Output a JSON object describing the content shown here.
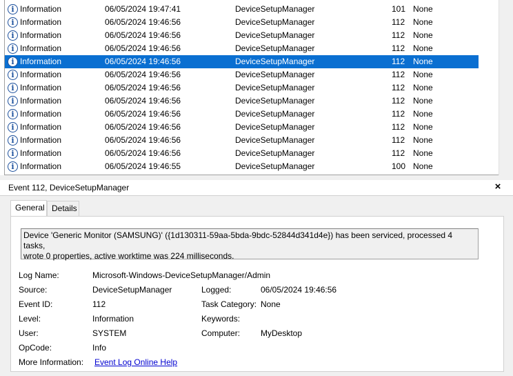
{
  "event_list": {
    "rows": [
      {
        "level": "Information",
        "date": "06/05/2024 19:47:41",
        "source": "DeviceSetupManager",
        "event_id": "101",
        "task": "None",
        "selected": false
      },
      {
        "level": "Information",
        "date": "06/05/2024 19:46:56",
        "source": "DeviceSetupManager",
        "event_id": "112",
        "task": "None",
        "selected": false
      },
      {
        "level": "Information",
        "date": "06/05/2024 19:46:56",
        "source": "DeviceSetupManager",
        "event_id": "112",
        "task": "None",
        "selected": false
      },
      {
        "level": "Information",
        "date": "06/05/2024 19:46:56",
        "source": "DeviceSetupManager",
        "event_id": "112",
        "task": "None",
        "selected": false
      },
      {
        "level": "Information",
        "date": "06/05/2024 19:46:56",
        "source": "DeviceSetupManager",
        "event_id": "112",
        "task": "None",
        "selected": true
      },
      {
        "level": "Information",
        "date": "06/05/2024 19:46:56",
        "source": "DeviceSetupManager",
        "event_id": "112",
        "task": "None",
        "selected": false
      },
      {
        "level": "Information",
        "date": "06/05/2024 19:46:56",
        "source": "DeviceSetupManager",
        "event_id": "112",
        "task": "None",
        "selected": false
      },
      {
        "level": "Information",
        "date": "06/05/2024 19:46:56",
        "source": "DeviceSetupManager",
        "event_id": "112",
        "task": "None",
        "selected": false
      },
      {
        "level": "Information",
        "date": "06/05/2024 19:46:56",
        "source": "DeviceSetupManager",
        "event_id": "112",
        "task": "None",
        "selected": false
      },
      {
        "level": "Information",
        "date": "06/05/2024 19:46:56",
        "source": "DeviceSetupManager",
        "event_id": "112",
        "task": "None",
        "selected": false
      },
      {
        "level": "Information",
        "date": "06/05/2024 19:46:56",
        "source": "DeviceSetupManager",
        "event_id": "112",
        "task": "None",
        "selected": false
      },
      {
        "level": "Information",
        "date": "06/05/2024 19:46:56",
        "source": "DeviceSetupManager",
        "event_id": "112",
        "task": "None",
        "selected": false
      },
      {
        "level": "Information",
        "date": "06/05/2024 19:46:55",
        "source": "DeviceSetupManager",
        "event_id": "100",
        "task": "None",
        "selected": false
      }
    ],
    "icon": "info-icon",
    "selection_color": "#0a6fd1"
  },
  "detail": {
    "title": "Event 112, DeviceSetupManager",
    "close_icon": "×",
    "tabs": {
      "general": "General",
      "details": "Details"
    },
    "message_line1": "Device 'Generic Monitor (SAMSUNG)' ({1d130311-59aa-5bda-9bdc-52844d341d4e}) has been serviced, processed 4 tasks,",
    "message_line2": "wrote 0 properties, active worktime was 224 milliseconds.",
    "labels": {
      "log_name": "Log Name:",
      "source": "Source:",
      "logged": "Logged:",
      "event_id": "Event ID:",
      "task_category": "Task Category:",
      "level": "Level:",
      "keywords": "Keywords:",
      "user": "User:",
      "computer": "Computer:",
      "opcode": "OpCode:",
      "more_info": "More Information:"
    },
    "values": {
      "log_name": "Microsoft-Windows-DeviceSetupManager/Admin",
      "source": "DeviceSetupManager",
      "logged": "06/05/2024 19:46:56",
      "event_id": "112",
      "task_category": "None",
      "level": "Information",
      "keywords": "",
      "user": "SYSTEM",
      "computer": "MyDesktop",
      "opcode": "Info",
      "more_info_link": "Event Log Online Help"
    }
  }
}
